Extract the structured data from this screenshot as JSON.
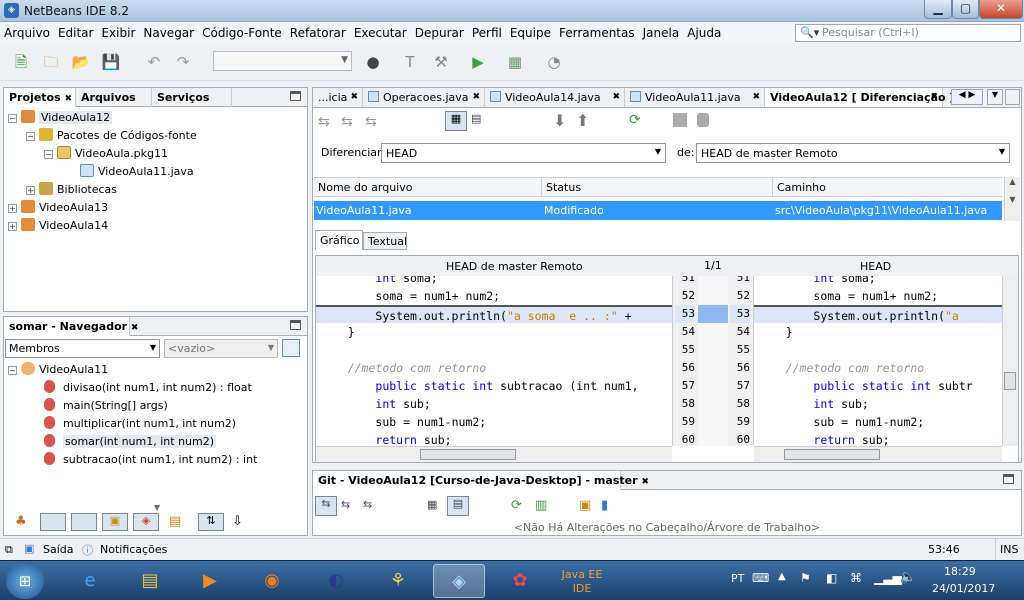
{
  "window": {
    "title": "NetBeans IDE 8.2"
  },
  "menu": [
    "Arquivo",
    "Editar",
    "Exibir",
    "Navegar",
    "Código-Fonte",
    "Refatorar",
    "Executar",
    "Depurar",
    "Perfil",
    "Equipe",
    "Ferramentas",
    "Janela",
    "Ajuda"
  ],
  "search": {
    "placeholder": "Pesquisar (Ctrl+I)"
  },
  "projects_panel": {
    "tabs": [
      "Projetos",
      "Arquivos",
      "Serviços"
    ],
    "tree": {
      "project1": "VideoAula12",
      "src_pkgs": "Pacotes de Códigos-fonte",
      "pkg": "VideoAula.pkg11",
      "file": "VideoAula11.java",
      "libs": "Bibliotecas",
      "project2": "VideoAula13",
      "project3": "VideoAula14"
    }
  },
  "navigator_panel": {
    "title": "somar - Navegador",
    "members_select": "Membros",
    "filter_select": "<vazio>",
    "class_name": "VideoAula11",
    "methods": [
      {
        "name": "divisao",
        "params": "(int num1, int num2) : float"
      },
      {
        "name": "main",
        "params": "(String[] args)"
      },
      {
        "name": "multiplicar",
        "params": "(int num1, int num2)"
      },
      {
        "name": "somar",
        "params": "(int num1, int num2)"
      },
      {
        "name": "subtracao",
        "params": "(int num1, int num2) : int"
      }
    ]
  },
  "editor_tabs": [
    "...icia",
    "Operacoes.java",
    "VideoAula14.java",
    "VideoAula11.java",
    "VideoAula12 [ Diferenciação ]"
  ],
  "diff": {
    "diff_label": "Diferenciar:",
    "diff_value": "HEAD",
    "from_label": "de:",
    "from_value": "HEAD de master Remoto",
    "table": {
      "headers": [
        "Nome do arquivo",
        "Status",
        "Caminho"
      ],
      "row": [
        "VideoAula11.java",
        "Modificado",
        "src\\VideoAula\\pkg11\\VideoAula11.java"
      ]
    },
    "view_tabs": [
      "Gráfico",
      "Textual"
    ],
    "left_header": "HEAD de master Remoto",
    "counter": "1/1",
    "right_header": "HEAD",
    "line_numbers": [
      "51",
      "52",
      "53",
      "54",
      "55",
      "56",
      "57",
      "58",
      "59",
      "60"
    ],
    "left_code": [
      "    int soma;",
      "    soma = num1+ num2;",
      "    System.out.println(\"a soma  e .. :\" +",
      "  }",
      "",
      "  //metodo com retorno",
      "    public static int subtracao (int num1,",
      "    int sub;",
      "    sub = num1-num2;",
      "    return sub;"
    ],
    "right_code": [
      "    int soma;",
      "    soma = num1+ num2;",
      "    System.out.println(\"a",
      "  }",
      "",
      "  //metodo com retorno",
      "    public static int subtr",
      "    int sub;",
      "    sub = num1-num2;",
      "    return sub;"
    ]
  },
  "git_panel": {
    "title": "Git - VideoAula12 [Curso-de-Java-Desktop] - master",
    "message": "<Não Há Alterações no Cabeçalho/Árvore de Trabalho>"
  },
  "statusbar": {
    "output": "Saída",
    "notifications": "Notificações",
    "position": "53:46",
    "mode": "INS"
  },
  "taskbar": {
    "lang": "PT",
    "time": "18:29",
    "date": "24/01/2017"
  },
  "colors": {
    "selection": "#3399ff",
    "changed_line": "#dde6f6",
    "keyword": "#0000e6",
    "string": "#ce7b00",
    "comment": "#969696"
  }
}
